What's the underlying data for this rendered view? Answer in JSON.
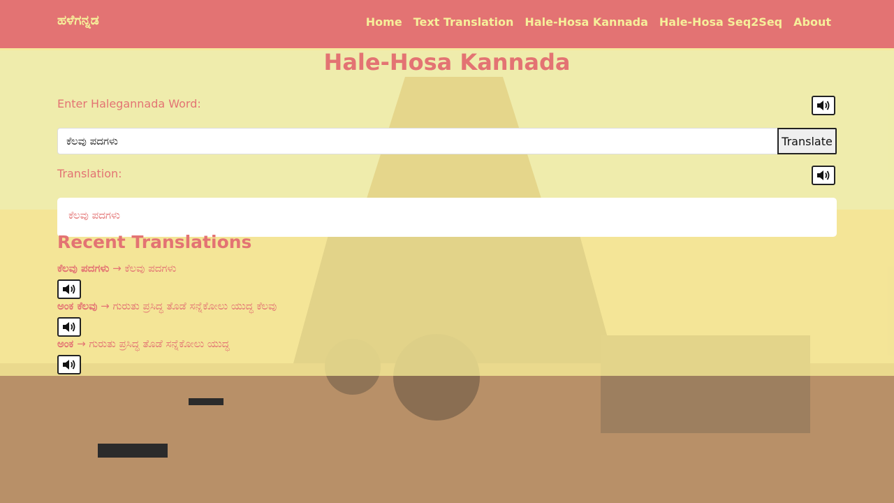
{
  "navbar": {
    "brand": "ಹಳೆಗನ್ನಡ",
    "links": [
      "Home",
      "Text Translation",
      "Hale-Hosa Kannada",
      "Hale-Hosa Seq2Seq",
      "About"
    ]
  },
  "main": {
    "title": "Hale-Hosa Kannada",
    "input_label": "Enter Halegannada Word:",
    "input_value": "ಕೆಲವು ಪದಗಳು",
    "translate_label": "Translate",
    "translation_label": "Translation:",
    "translation_value": "ಕೆಲವು ಪದಗಳು"
  },
  "recent": {
    "title": "Recent Translations",
    "arrow": "→",
    "items": [
      {
        "source": "ಕೆಲವು ಪದಗಳು",
        "target": "ಕೆಲವು ಪದಗಳು"
      },
      {
        "source": "ಅಂಕ ಕೆಲವು",
        "target": "ಗುರುತು ಪ್ರಸಿದ್ಧ ತೊಡೆ ಸನ್ನೆಕೋಲು ಯುದ್ಧ ಕೆಲವು"
      },
      {
        "source": "ಅಂಕ",
        "target": "ಗುರುತು ಪ್ರಸಿದ್ಧ ತೊಡೆ ಸನ್ನೆಕೋಲು ಯುದ್ಧ"
      }
    ]
  },
  "icons": {
    "speaker": "speaker-icon"
  },
  "colors": {
    "navbar": "#e37373",
    "accent_text": "#e37373",
    "brand_text": "#f6ef9a",
    "overlay": "#fdf59b"
  }
}
